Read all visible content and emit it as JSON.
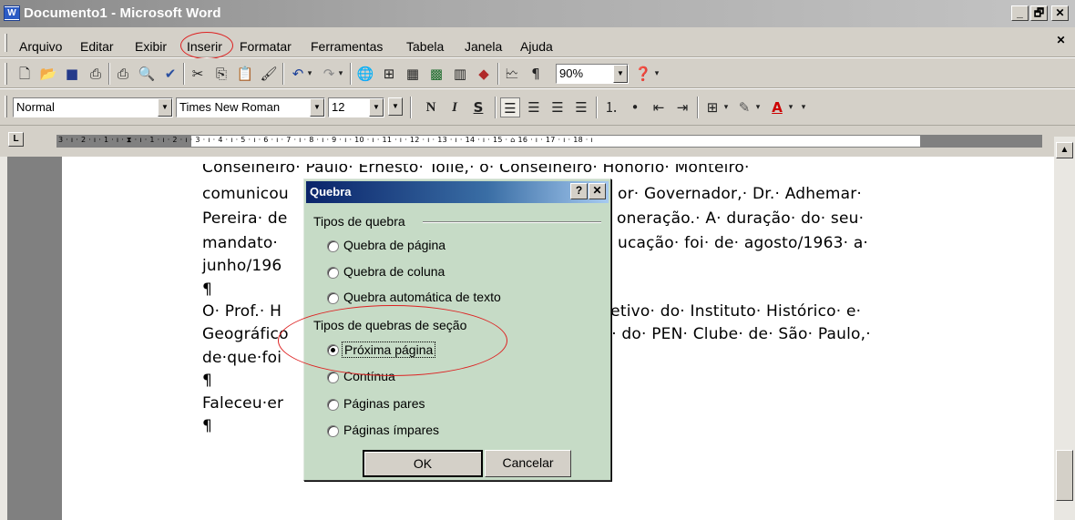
{
  "window": {
    "title": "Documento1 - Microsoft Word",
    "app_icon": "W",
    "min": "_",
    "max": "🗗",
    "close": "✕"
  },
  "menu": {
    "items": [
      "Arquivo",
      "Editar",
      "Exibir",
      "Inserir",
      "Formatar",
      "Ferramentas",
      "Tabela",
      "Janela",
      "Ajuda"
    ],
    "close": "✕"
  },
  "toolbar": {
    "zoom": "90%",
    "style": "Normal",
    "font": "Times New Roman",
    "size": "12",
    "bold": "N",
    "italic": "I",
    "underline": "S"
  },
  "ruler": {
    "tab_selector": "L",
    "ticks": "3 · ı · 2 · ı · 1 · ı · ⧗ · ı · 1 · ı · 2 · ı · 3 · ı · 4 · ı · 5 · ı · 6 · ı · 7 · ı · 8 · ı · 9 · ı · 10 · ı · 11 · ı · 12 · ı · 13 · ı · 14 · ı · 15 · ⌂ 16 · ı · 17 · ı · 18 · ı"
  },
  "document": {
    "lines": [
      "Conselheiro· Paulo· Ernesto· Tolle,· o· Conselheiro· Honorio· Monteiro·",
      "comunicou",
      "or· Governador,· Dr.· Adhemar·",
      "Pereira· de",
      "oneração.· A· duração· do· seu·",
      "mandato·",
      "ucação· foi· de· agosto/1963· a·",
      "junho/196",
      "¶",
      "O· Prof.· H",
      "fetivo· do· Instituto· Histórico· e·",
      "Geográfico",
      "r· do· PEN· Clube· de· São· Paulo,·",
      "de·que·foi",
      "¶",
      "Faleceu·er",
      "¶"
    ]
  },
  "dialog": {
    "title": "Quebra",
    "help": "?",
    "close": "✕",
    "group1": "Tipos de quebra",
    "group2": "Tipos de quebras de seção",
    "options1": [
      "Quebra de página",
      "Quebra de coluna",
      "Quebra automática de texto"
    ],
    "options2": [
      "Próxima página",
      "Contínua",
      "Páginas pares",
      "Páginas ímpares"
    ],
    "selected": "Próxima página",
    "ok": "OK",
    "cancel": "Cancelar"
  },
  "colors": {
    "title_grey": "#a9a9a9",
    "dialog_bg": "#c6dbc6",
    "dialog_title": "#0a246a",
    "annotation": "#dd2222"
  }
}
